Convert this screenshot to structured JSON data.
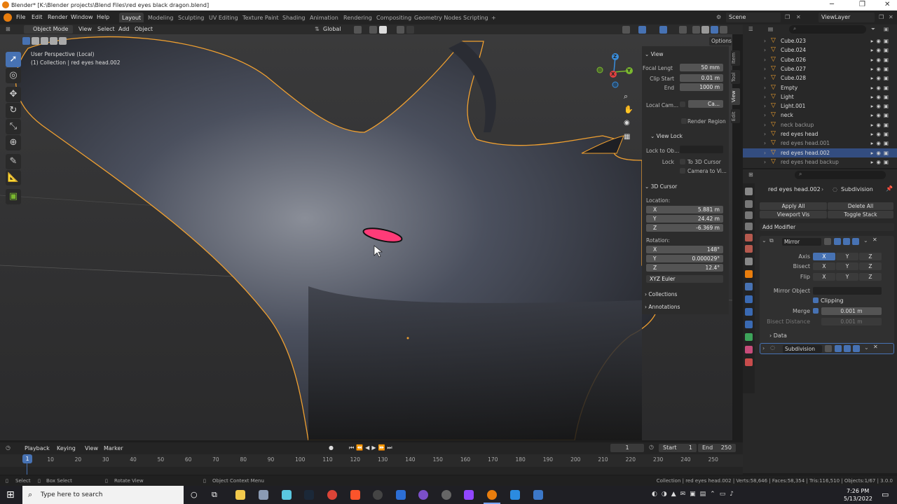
{
  "window": {
    "title": "Blender* [K:\\Blender projects\\Blend Files\\red eyes black dragon.blend]",
    "minimize": "─",
    "maximize": "❐",
    "close": "✕"
  },
  "menu": {
    "items": [
      "File",
      "Edit",
      "Render",
      "Window",
      "Help"
    ],
    "workspaces": [
      "Layout",
      "Modeling",
      "Sculpting",
      "UV Editing",
      "Texture Paint",
      "Shading",
      "Animation",
      "Rendering",
      "Compositing",
      "Geometry Nodes",
      "Scripting",
      "+"
    ],
    "scene": "Scene",
    "view_layer": "ViewLayer"
  },
  "viewport_header": {
    "mode": "Object Mode",
    "menus": [
      "View",
      "Select",
      "Add",
      "Object"
    ],
    "transform": "Global",
    "options": "Options"
  },
  "viewport": {
    "perspective": "User Perspective (Local)",
    "collection": "(1) Collection | red eyes head.002"
  },
  "gizmo": {
    "x": "X",
    "y": "Y",
    "z": "Z"
  },
  "npanel": {
    "tabs": [
      "Item",
      "Tool",
      "View",
      "Edit"
    ],
    "view_header": "View",
    "focal_label": "Focal Lengt",
    "focal_value": "50 mm",
    "clip_start_label": "Clip Start",
    "clip_start_value": "0.01 m",
    "end_label": "End",
    "end_value": "1000 m",
    "local_cam_label": "Local Cam...",
    "local_cam_value": "Ca...",
    "render_region": "Render Region",
    "view_lock_header": "View Lock",
    "lock_to_obj_label": "Lock to Ob...",
    "lock_label": "Lock",
    "to_3d_cursor": "To 3D Cursor",
    "camera_to_view": "Camera to Vi...",
    "cursor_header": "3D Cursor",
    "location_label": "Location:",
    "loc_x": "5.881 m",
    "loc_y": "24.42 m",
    "loc_z": "-6.369 m",
    "rotation_label": "Rotation:",
    "rot_x": "148°",
    "rot_y": "0.000029°",
    "rot_z": "12.4°",
    "rot_mode": "XYZ Euler",
    "collections": "Collections",
    "annotations": "Annotations",
    "x": "X",
    "y": "Y",
    "z": "Z"
  },
  "outliner": {
    "rows": [
      {
        "name": "Cube.023",
        "dim": false,
        "sel": false
      },
      {
        "name": "Cube.024",
        "dim": false,
        "sel": false
      },
      {
        "name": "Cube.026",
        "dim": false,
        "sel": false
      },
      {
        "name": "Cube.027",
        "dim": false,
        "sel": false
      },
      {
        "name": "Cube.028",
        "dim": false,
        "sel": false
      },
      {
        "name": "Empty",
        "dim": false,
        "sel": false
      },
      {
        "name": "Light",
        "dim": false,
        "sel": false
      },
      {
        "name": "Light.001",
        "dim": false,
        "sel": false
      },
      {
        "name": "neck",
        "dim": false,
        "sel": false
      },
      {
        "name": "neck backup",
        "dim": true,
        "sel": false
      },
      {
        "name": "red eyes head",
        "dim": false,
        "sel": false
      },
      {
        "name": "red eyes head.001",
        "dim": true,
        "sel": false
      },
      {
        "name": "red eyes head.002",
        "dim": false,
        "sel": true
      },
      {
        "name": "red eyes head backup",
        "dim": true,
        "sel": false
      }
    ]
  },
  "properties": {
    "breadcrumb_object": "red eyes head.002",
    "breadcrumb_modifier": "Subdivision",
    "apply_all": "Apply All",
    "delete_all": "Delete All",
    "viewport_vis": "Viewport Vis",
    "toggle_stack": "Toggle Stack",
    "add_modifier": "Add Modifier",
    "mirror_name": "Mirror",
    "axis_label": "Axis",
    "bisect_label": "Bisect",
    "flip_label": "Flip",
    "x": "X",
    "y": "Y",
    "z": "Z",
    "mirror_object_label": "Mirror Object",
    "clipping": "Clipping",
    "merge_label": "Merge",
    "merge_value": "0.001 m",
    "bisect_distance_label": "Bisect Distance",
    "bisect_distance_value": "0.001 m",
    "data": "Data",
    "subdivision_name": "Subdivision"
  },
  "timeline": {
    "playback": "Playback",
    "keying": "Keying",
    "view": "View",
    "marker": "Marker",
    "current_frame": "1",
    "start_label": "Start",
    "start_value": "1",
    "end_label": "End",
    "end_value": "250",
    "ticks": [
      "1",
      "10",
      "20",
      "30",
      "40",
      "50",
      "60",
      "70",
      "80",
      "90",
      "100",
      "110",
      "120",
      "130",
      "140",
      "150",
      "160",
      "170",
      "180",
      "190",
      "200",
      "210",
      "220",
      "230",
      "240",
      "250"
    ]
  },
  "statusbar": {
    "select": "Select",
    "box_select": "Box Select",
    "rotate_view": "Rotate View",
    "context_menu": "Object Context Menu",
    "stats": "Collection | red eyes head.002 | Verts:58,646 | Faces:58,354 | Tris:116,510 | Objects:1/67 | 3.0.0"
  },
  "taskbar": {
    "search_placeholder": "Type here to search",
    "time": "7:26 PM",
    "date": "5/13/2022"
  },
  "colors": {
    "accent": "#4772b3",
    "orange": "#e87d0d",
    "selection_outline": "#f0a030",
    "eye": "#ff3b78"
  }
}
